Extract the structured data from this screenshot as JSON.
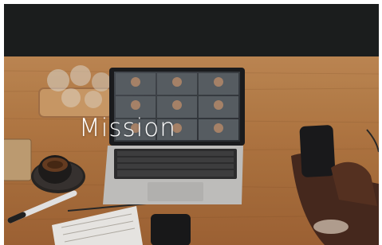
{
  "hero": {
    "title": "Mission"
  },
  "colors": {
    "topbar": "#1b1d1d",
    "table": "#b67a45",
    "title": "#ffffff"
  }
}
